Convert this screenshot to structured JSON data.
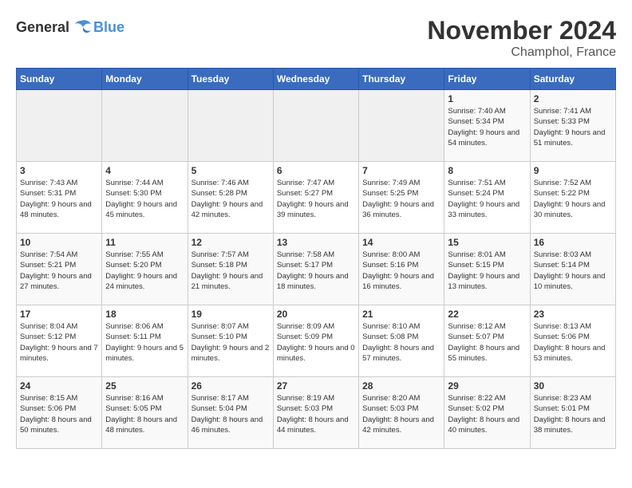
{
  "header": {
    "logo_general": "General",
    "logo_blue": "Blue",
    "month_title": "November 2024",
    "location": "Champhol, France"
  },
  "weekdays": [
    "Sunday",
    "Monday",
    "Tuesday",
    "Wednesday",
    "Thursday",
    "Friday",
    "Saturday"
  ],
  "weeks": [
    [
      {
        "day": "",
        "info": ""
      },
      {
        "day": "",
        "info": ""
      },
      {
        "day": "",
        "info": ""
      },
      {
        "day": "",
        "info": ""
      },
      {
        "day": "",
        "info": ""
      },
      {
        "day": "1",
        "info": "Sunrise: 7:40 AM\nSunset: 5:34 PM\nDaylight: 9 hours and 54 minutes."
      },
      {
        "day": "2",
        "info": "Sunrise: 7:41 AM\nSunset: 5:33 PM\nDaylight: 9 hours and 51 minutes."
      }
    ],
    [
      {
        "day": "3",
        "info": "Sunrise: 7:43 AM\nSunset: 5:31 PM\nDaylight: 9 hours and 48 minutes."
      },
      {
        "day": "4",
        "info": "Sunrise: 7:44 AM\nSunset: 5:30 PM\nDaylight: 9 hours and 45 minutes."
      },
      {
        "day": "5",
        "info": "Sunrise: 7:46 AM\nSunset: 5:28 PM\nDaylight: 9 hours and 42 minutes."
      },
      {
        "day": "6",
        "info": "Sunrise: 7:47 AM\nSunset: 5:27 PM\nDaylight: 9 hours and 39 minutes."
      },
      {
        "day": "7",
        "info": "Sunrise: 7:49 AM\nSunset: 5:25 PM\nDaylight: 9 hours and 36 minutes."
      },
      {
        "day": "8",
        "info": "Sunrise: 7:51 AM\nSunset: 5:24 PM\nDaylight: 9 hours and 33 minutes."
      },
      {
        "day": "9",
        "info": "Sunrise: 7:52 AM\nSunset: 5:22 PM\nDaylight: 9 hours and 30 minutes."
      }
    ],
    [
      {
        "day": "10",
        "info": "Sunrise: 7:54 AM\nSunset: 5:21 PM\nDaylight: 9 hours and 27 minutes."
      },
      {
        "day": "11",
        "info": "Sunrise: 7:55 AM\nSunset: 5:20 PM\nDaylight: 9 hours and 24 minutes."
      },
      {
        "day": "12",
        "info": "Sunrise: 7:57 AM\nSunset: 5:18 PM\nDaylight: 9 hours and 21 minutes."
      },
      {
        "day": "13",
        "info": "Sunrise: 7:58 AM\nSunset: 5:17 PM\nDaylight: 9 hours and 18 minutes."
      },
      {
        "day": "14",
        "info": "Sunrise: 8:00 AM\nSunset: 5:16 PM\nDaylight: 9 hours and 16 minutes."
      },
      {
        "day": "15",
        "info": "Sunrise: 8:01 AM\nSunset: 5:15 PM\nDaylight: 9 hours and 13 minutes."
      },
      {
        "day": "16",
        "info": "Sunrise: 8:03 AM\nSunset: 5:14 PM\nDaylight: 9 hours and 10 minutes."
      }
    ],
    [
      {
        "day": "17",
        "info": "Sunrise: 8:04 AM\nSunset: 5:12 PM\nDaylight: 9 hours and 7 minutes."
      },
      {
        "day": "18",
        "info": "Sunrise: 8:06 AM\nSunset: 5:11 PM\nDaylight: 9 hours and 5 minutes."
      },
      {
        "day": "19",
        "info": "Sunrise: 8:07 AM\nSunset: 5:10 PM\nDaylight: 9 hours and 2 minutes."
      },
      {
        "day": "20",
        "info": "Sunrise: 8:09 AM\nSunset: 5:09 PM\nDaylight: 9 hours and 0 minutes."
      },
      {
        "day": "21",
        "info": "Sunrise: 8:10 AM\nSunset: 5:08 PM\nDaylight: 8 hours and 57 minutes."
      },
      {
        "day": "22",
        "info": "Sunrise: 8:12 AM\nSunset: 5:07 PM\nDaylight: 8 hours and 55 minutes."
      },
      {
        "day": "23",
        "info": "Sunrise: 8:13 AM\nSunset: 5:06 PM\nDaylight: 8 hours and 53 minutes."
      }
    ],
    [
      {
        "day": "24",
        "info": "Sunrise: 8:15 AM\nSunset: 5:06 PM\nDaylight: 8 hours and 50 minutes."
      },
      {
        "day": "25",
        "info": "Sunrise: 8:16 AM\nSunset: 5:05 PM\nDaylight: 8 hours and 48 minutes."
      },
      {
        "day": "26",
        "info": "Sunrise: 8:17 AM\nSunset: 5:04 PM\nDaylight: 8 hours and 46 minutes."
      },
      {
        "day": "27",
        "info": "Sunrise: 8:19 AM\nSunset: 5:03 PM\nDaylight: 8 hours and 44 minutes."
      },
      {
        "day": "28",
        "info": "Sunrise: 8:20 AM\nSunset: 5:03 PM\nDaylight: 8 hours and 42 minutes."
      },
      {
        "day": "29",
        "info": "Sunrise: 8:22 AM\nSunset: 5:02 PM\nDaylight: 8 hours and 40 minutes."
      },
      {
        "day": "30",
        "info": "Sunrise: 8:23 AM\nSunset: 5:01 PM\nDaylight: 8 hours and 38 minutes."
      }
    ]
  ]
}
